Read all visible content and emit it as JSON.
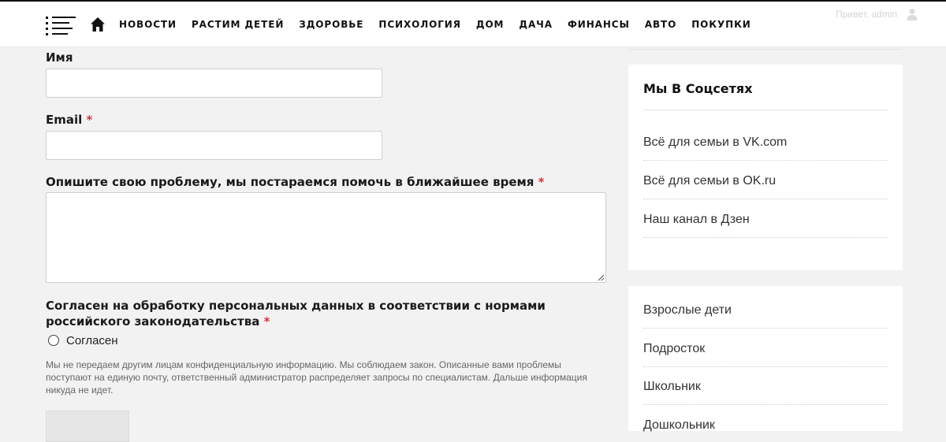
{
  "header": {
    "nav": [
      "НОВОСТИ",
      "РАСТИМ ДЕТЕЙ",
      "ЗДОРОВЬЕ",
      "ПСИХОЛОГИЯ",
      "ДОМ",
      "ДАЧА",
      "ФИНАНСЫ",
      "АВТО",
      "ПОКУПКИ"
    ],
    "greeting": "Привет, admin"
  },
  "form": {
    "name_label": "Имя",
    "email_label": "Email",
    "problem_label": "Опишите свою проблему, мы постараемся помочь в ближайшее время",
    "required_mark": "*",
    "consent_label": "Согласен на обработку персональных данных в соответствии с нормами российского законодательства",
    "consent_option": "Согласен",
    "note": "Мы не передаем другим лицам конфиденциальную информацию. Мы соблюдаем закон. Описанные вами проблемы поступают на единую почту, ответственный администратор распределяет запросы по специалистам. Дальше информация никуда не идет."
  },
  "sidebar": {
    "social_title": "Мы В Соцсетях",
    "social_links": [
      "Всё для семьи в VK.com",
      "Всё для семьи в OK.ru",
      "Наш канал в Дзен"
    ],
    "categories": [
      "Взрослые дети",
      "Подросток",
      "Школьник",
      "Дошкольник"
    ]
  },
  "colors": {
    "required": "#d9313c",
    "text": "#1a1a1a",
    "background": "#f2f2f2"
  },
  "icons": [
    "menu-icon",
    "home-icon",
    "user-icon",
    "moon-icon",
    "resize-handle-icon"
  ]
}
